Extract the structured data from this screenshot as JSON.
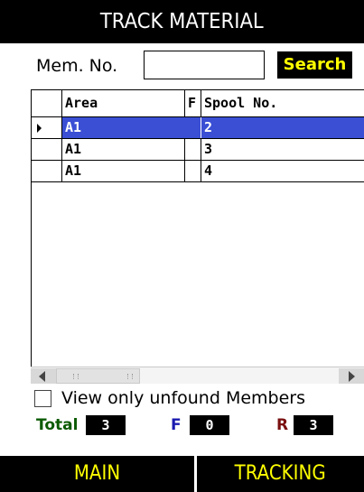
{
  "title": "TRACK MATERIAL",
  "search": {
    "label": "Mem. No.",
    "value": "",
    "button_label": "Search"
  },
  "grid": {
    "columns": [
      "Area",
      "F",
      "Spool No."
    ],
    "rows": [
      {
        "area": "A1",
        "f": "",
        "spool": "2",
        "selected": true
      },
      {
        "area": "A1",
        "f": "",
        "spool": "3",
        "selected": false
      },
      {
        "area": "A1",
        "f": "",
        "spool": "4",
        "selected": false
      }
    ]
  },
  "filter": {
    "label": "View only unfound Members",
    "checked": false
  },
  "counters": {
    "total_label": "Total",
    "total_value": "3",
    "f_label": "F",
    "f_value": "0",
    "r_label": "R",
    "r_value": "3"
  },
  "colors": {
    "accent_yellow": "#ffff00",
    "selected_row": "#3a4fd4",
    "total_label": "#0a5a00",
    "f_label": "#1a1ab0",
    "r_label": "#7a1010"
  },
  "bottom_nav": {
    "main_label": "MAIN",
    "tracking_label": "TRACKING"
  }
}
